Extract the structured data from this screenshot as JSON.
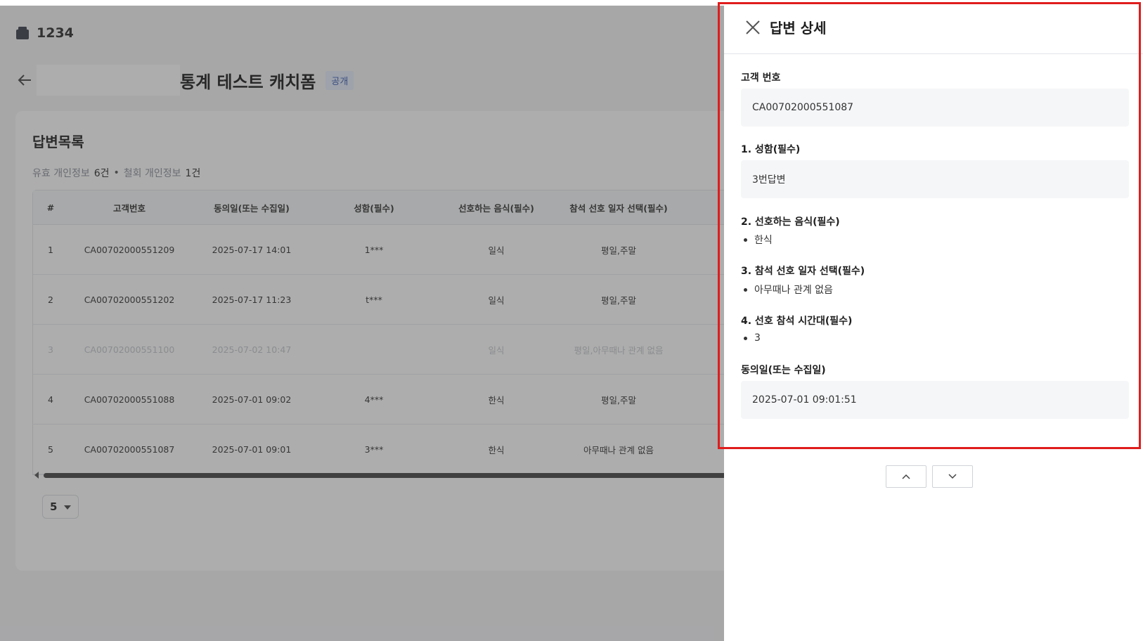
{
  "app": {
    "store_name": "1234",
    "form_title": "통계 테스트 캐치폼",
    "badge": "공개"
  },
  "list": {
    "title": "답변목록",
    "summary": {
      "valid_label": "유효 개인정보",
      "valid_count": "6건",
      "separator": "•",
      "withdrawn_label": "철회 개인정보",
      "withdrawn_count": "1건"
    },
    "columns": [
      "#",
      "고객번호",
      "동의일(또는 수집일)",
      "성함(필수)",
      "선호하는 음식(필수)",
      "참석 선호 일자 선택(필수)",
      ""
    ],
    "rows": [
      {
        "cells": [
          "1",
          "CA00702000551209",
          "2025-07-17 14:01",
          "1***",
          "일식",
          "평일,주말",
          ""
        ],
        "dimmed": false
      },
      {
        "cells": [
          "2",
          "CA00702000551202",
          "2025-07-17 11:23",
          "t***",
          "일식",
          "평일,주말",
          ""
        ],
        "dimmed": false
      },
      {
        "cells": [
          "3",
          "CA00702000551100",
          "2025-07-02 10:47",
          "",
          "일식",
          "평일,아무때나 관계 없음",
          ""
        ],
        "dimmed": true
      },
      {
        "cells": [
          "4",
          "CA00702000551088",
          "2025-07-01 09:02",
          "4***",
          "한식",
          "평일,주말",
          ""
        ],
        "dimmed": false
      },
      {
        "cells": [
          "5",
          "CA00702000551087",
          "2025-07-01 09:01",
          "3***",
          "한식",
          "아무때나 관계 없음",
          ""
        ],
        "dimmed": false
      }
    ],
    "page_size": "5"
  },
  "drawer": {
    "title": "답변 상세",
    "customer_label": "고객 번호",
    "customer_value": "CA00702000551087",
    "q1_label": "1. 성함(필수)",
    "q1_value": "3번답변",
    "q2_label": "2. 선호하는 음식(필수)",
    "q2_item": "한식",
    "q3_label": "3. 참석 선호 일자 선택(필수)",
    "q3_item": "아무때나 관계 없음",
    "q4_label": "4. 선호 참석 시간대(필수)",
    "q4_item": "3",
    "consent_label": "동의일(또는 수집일)",
    "consent_value": "2025-07-01 09:01:51"
  },
  "icons": {
    "store": "store-icon",
    "back": "arrow-left-icon",
    "close": "close-icon",
    "prev": "chevron-up-icon",
    "next": "chevron-down-icon"
  },
  "colors": {
    "highlight_frame": "#e01c1c",
    "badge_bg": "#e4ecfb",
    "badge_text": "#3b5bb0"
  }
}
